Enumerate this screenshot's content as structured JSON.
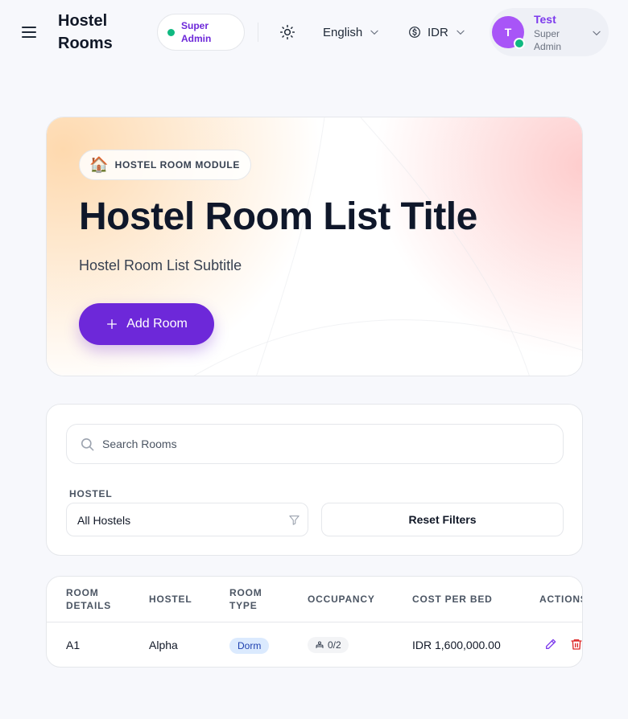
{
  "header": {
    "brand": "Hostel Rooms",
    "role_badge": "Super Admin",
    "language": "English",
    "currency": "IDR",
    "user": {
      "initial": "T",
      "name": "Test",
      "role": "Super Admin"
    }
  },
  "hero": {
    "badge_icon": "🏠",
    "badge": "HOSTEL ROOM MODULE",
    "title": "Hostel Room List Title",
    "subtitle": "Hostel Room List Subtitle",
    "add_button": "Add Room"
  },
  "filters": {
    "search_placeholder": "Search Rooms",
    "search_value": "",
    "hostel_label": "HOSTEL",
    "hostel_selected": "All Hostels",
    "reset_button": "Reset Filters"
  },
  "table": {
    "headers": {
      "room_details": "ROOM DETAILS",
      "hostel": "HOSTEL",
      "room_type": "ROOM TYPE",
      "occupancy": "OCCUPANCY",
      "cost_per_bed": "COST PER BED",
      "actions": "ACTIONS"
    },
    "rows": [
      {
        "room": "A1",
        "hostel": "Alpha",
        "type": "Dorm",
        "occupancy": "0/2",
        "cost": "IDR 1,600,000.00"
      }
    ]
  },
  "colors": {
    "accent": "#6d28d9",
    "online": "#10b981",
    "avatar": "#a855f7",
    "delete": "#dc2626"
  },
  "icons": [
    "menu-icon",
    "sun-icon",
    "chevron-down-icon",
    "dollar-icon",
    "search-icon",
    "filter-icon",
    "plus-icon",
    "pencil-icon",
    "trash-icon",
    "bed-icon"
  ]
}
